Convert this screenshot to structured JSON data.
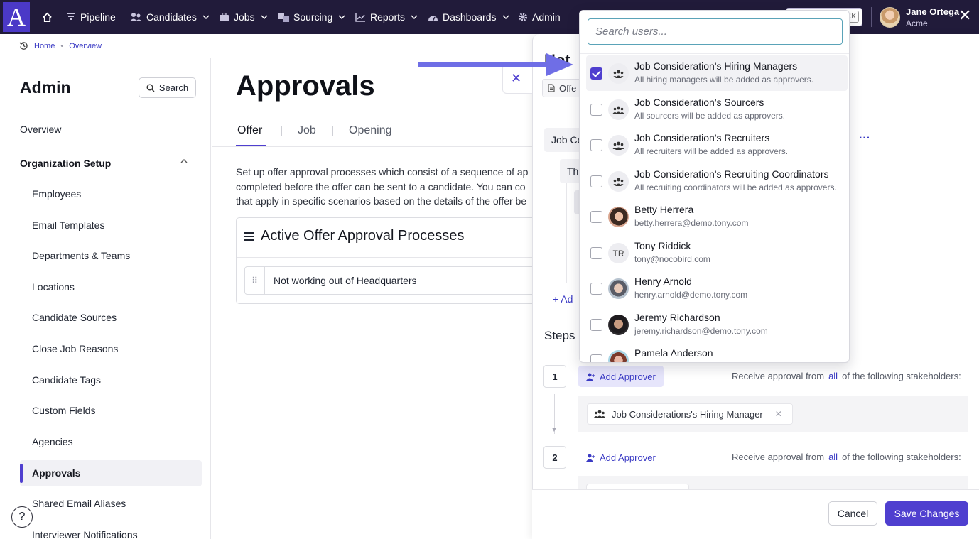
{
  "topnav": {
    "logo": "A",
    "items": [
      {
        "label": "Pipeline",
        "icon": "funnel-icon"
      },
      {
        "label": "Candidates",
        "icon": "people-icon"
      },
      {
        "label": "Jobs",
        "icon": "briefcase-icon"
      },
      {
        "label": "Sourcing",
        "icon": "sourcing-icon"
      },
      {
        "label": "Reports",
        "icon": "chart-icon"
      },
      {
        "label": "Dashboards",
        "icon": "gauge-icon"
      },
      {
        "label": "Admin",
        "icon": "gear-icon"
      }
    ],
    "search_shortcut": "⌘K",
    "user": {
      "name": "Jane Ortega",
      "org": "Acme"
    }
  },
  "breadcrumb": {
    "home": "Home",
    "current": "Overview"
  },
  "sidebar": {
    "title": "Admin",
    "search_label": "Search",
    "overview": "Overview",
    "section": "Organization Setup",
    "items": [
      "Employees",
      "Email Templates",
      "Departments & Teams",
      "Locations",
      "Candidate Sources",
      "Close Job Reasons",
      "Candidate Tags",
      "Custom Fields",
      "Agencies",
      "Approvals",
      "Shared Email Aliases",
      "Interviewer Notifications"
    ],
    "active_item": "Approvals",
    "help": "?"
  },
  "main": {
    "title": "Approvals",
    "tabs": [
      "Offer",
      "Job",
      "Opening"
    ],
    "active_tab": "Offer",
    "description": [
      "Set up offer approval processes which consist of a sequence of ap",
      "completed before the offer can be sent to a candidate. You can co",
      "that apply in specific scenarios based on the details of the offer be"
    ],
    "card_title": "Active Offer Approval Processes",
    "processes": [
      "Not working out of Headquarters"
    ]
  },
  "panel": {
    "title": "Not",
    "offer_chip": "Offe",
    "condition_label": "Job Co",
    "condition_inner": "Th",
    "add_link": "+ Ad",
    "steps_label": "Steps",
    "steps": [
      {
        "number": "1",
        "add_label": "Add Approver",
        "receive_prefix": "Receive approval from",
        "quantifier": "all",
        "receive_suffix": "of the following stakeholders:",
        "approvers": [
          "Job Considerations's Hiring Manager"
        ]
      },
      {
        "number": "2",
        "add_label": "Add Approver",
        "receive_prefix": "Receive approval from",
        "quantifier": "all",
        "receive_suffix": "of the following stakeholders:",
        "approvers": []
      }
    ],
    "cancel_label": "Cancel",
    "save_label": "Save Changes"
  },
  "dropdown": {
    "placeholder": "Search users...",
    "options": [
      {
        "title": "Job Consideration's Hiring Managers",
        "subtitle": "All hiring managers will be added as approvers.",
        "checked": true,
        "avatar": "group-icon"
      },
      {
        "title": "Job Consideration's Sourcers",
        "subtitle": "All sourcers will be added as approvers.",
        "checked": false,
        "avatar": "group-icon"
      },
      {
        "title": "Job Consideration's Recruiters",
        "subtitle": "All recruiters will be added as approvers.",
        "checked": false,
        "avatar": "group-icon"
      },
      {
        "title": "Job Consideration's Recruiting Coordinators",
        "subtitle": "All recruiting coordinators will be added as approvers.",
        "checked": false,
        "avatar": "group-icon"
      },
      {
        "title": "Betty Herrera",
        "subtitle": "betty.herrera@demo.tony.com",
        "checked": false,
        "avatar": "photo"
      },
      {
        "title": "Tony Riddick",
        "subtitle": "tony@nocobird.com",
        "checked": false,
        "avatar": "TR"
      },
      {
        "title": "Henry Arnold",
        "subtitle": "henry.arnold@demo.tony.com",
        "checked": false,
        "avatar": "photo"
      },
      {
        "title": "Jeremy Richardson",
        "subtitle": "jeremy.richardson@demo.tony.com",
        "checked": false,
        "avatar": "photo"
      },
      {
        "title": "Pamela Anderson",
        "subtitle": "",
        "checked": false,
        "avatar": "photo"
      }
    ]
  },
  "colors": {
    "nav": "#211b3a",
    "accent": "#4f3fcf",
    "link": "#3a3ac4",
    "arrow": "#6f6ee6"
  }
}
